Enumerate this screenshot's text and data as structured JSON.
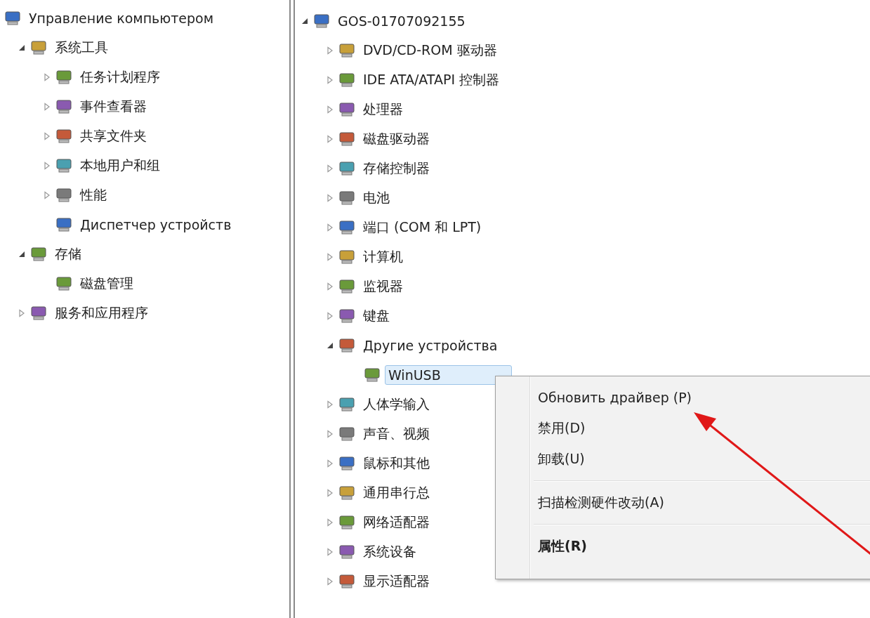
{
  "left_tree": [
    {
      "label": "Управление компьютером",
      "kind": "root",
      "selected": false,
      "children": [
        {
          "label": "系统工具",
          "kind": "node",
          "expanded": true,
          "selected": false,
          "children": [
            {
              "label": "任务计划程序",
              "kind": "node",
              "expanded": false,
              "selected": false
            },
            {
              "label": "事件查看器",
              "kind": "node",
              "expanded": false,
              "selected": false
            },
            {
              "label": "共享文件夹",
              "kind": "node",
              "expanded": false,
              "selected": false
            },
            {
              "label": "本地用户和组",
              "kind": "node",
              "expanded": false,
              "selected": false
            },
            {
              "label": "性能",
              "kind": "node",
              "expanded": false,
              "selected": false
            },
            {
              "label": "Диспетчер устройств",
              "kind": "leaf",
              "selected": false
            }
          ]
        },
        {
          "label": "存储",
          "kind": "node",
          "expanded": true,
          "selected": false,
          "children": [
            {
              "label": "磁盘管理",
              "kind": "leaf",
              "selected": false
            }
          ]
        },
        {
          "label": "服务和应用程序",
          "kind": "node",
          "expanded": false,
          "selected": false
        }
      ]
    }
  ],
  "right_tree": [
    {
      "label": "GOS-01707092155",
      "kind": "node",
      "expanded": true,
      "selected": false,
      "children": [
        {
          "label": "DVD/CD-ROM 驱动器",
          "kind": "node",
          "expanded": false,
          "selected": false
        },
        {
          "label": "IDE ATA/ATAPI 控制器",
          "kind": "node",
          "expanded": false,
          "selected": false
        },
        {
          "label": "处理器",
          "kind": "node",
          "expanded": false,
          "selected": false
        },
        {
          "label": "磁盘驱动器",
          "kind": "node",
          "expanded": false,
          "selected": false
        },
        {
          "label": "存储控制器",
          "kind": "node",
          "expanded": false,
          "selected": false
        },
        {
          "label": "电池",
          "kind": "node",
          "expanded": false,
          "selected": false
        },
        {
          "label": "端口 (COM 和 LPT)",
          "kind": "node",
          "expanded": false,
          "selected": false
        },
        {
          "label": "计算机",
          "kind": "node",
          "expanded": false,
          "selected": false
        },
        {
          "label": "监视器",
          "kind": "node",
          "expanded": false,
          "selected": false
        },
        {
          "label": "键盘",
          "kind": "node",
          "expanded": false,
          "selected": false
        },
        {
          "label": "Другие устройства",
          "kind": "node",
          "expanded": true,
          "selected": false,
          "children": [
            {
              "label": "WinUSB",
              "kind": "leaf",
              "selected": true
            }
          ]
        },
        {
          "label": "人体学输入",
          "kind": "node",
          "expanded": false,
          "selected": false
        },
        {
          "label": "声音、视频",
          "kind": "node",
          "expanded": false,
          "selected": false
        },
        {
          "label": "鼠标和其他",
          "kind": "node",
          "expanded": false,
          "selected": false
        },
        {
          "label": "通用串行总",
          "kind": "node",
          "expanded": false,
          "selected": false
        },
        {
          "label": "网络适配器",
          "kind": "node",
          "expanded": false,
          "selected": false
        },
        {
          "label": "系统设备",
          "kind": "node",
          "expanded": false,
          "selected": false
        },
        {
          "label": "显示适配器",
          "kind": "node",
          "expanded": false,
          "selected": false
        }
      ]
    }
  ],
  "context_menu": [
    {
      "kind": "item",
      "label": "Обновить драйвер (P)",
      "default": false
    },
    {
      "kind": "item",
      "label": "禁用(D)",
      "default": false
    },
    {
      "kind": "item",
      "label": "卸载(U)",
      "default": false
    },
    {
      "kind": "separator"
    },
    {
      "kind": "item",
      "label": "扫描检测硬件改动(A)",
      "default": false
    },
    {
      "kind": "separator"
    },
    {
      "kind": "item",
      "label": "属性(R)",
      "default": true
    }
  ]
}
